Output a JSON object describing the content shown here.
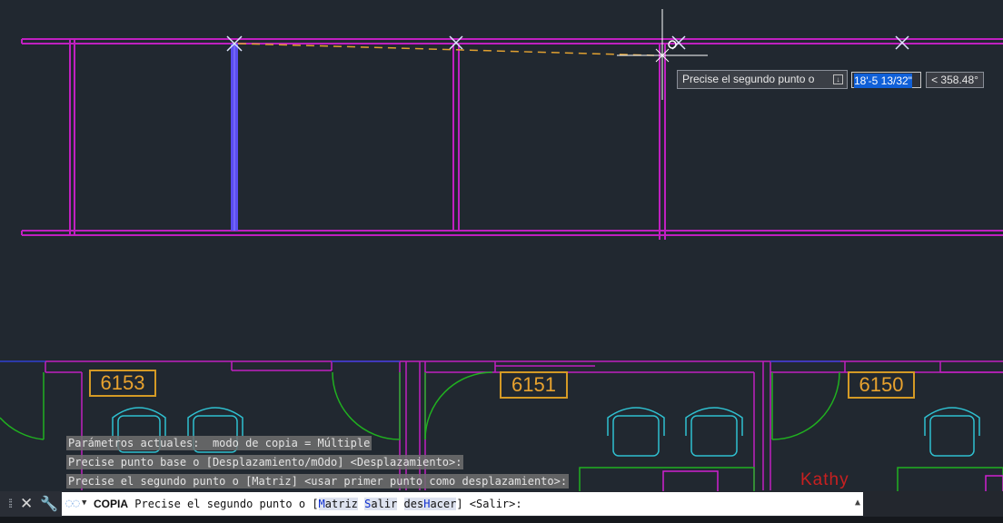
{
  "dynamic_input": {
    "prompt": "Precise el segundo punto o",
    "distance": "18'-5 13/32\"",
    "angle": "< 358.48°"
  },
  "rooms": [
    {
      "label": "6153"
    },
    {
      "label": "6151"
    },
    {
      "label": "6150"
    }
  ],
  "name_tag": "Kathy",
  "history": [
    "Parámetros actuales:  modo de copia = Múltiple",
    "Precise punto base o [Desplazamiento/mOdo] <Desplazamiento>:",
    "Precise el segundo punto o [Matriz] <usar primer punto como desplazamiento>:"
  ],
  "command_line": {
    "command": "COPIA",
    "prompt": "Precise el segundo punto o [",
    "options": [
      {
        "pre": "",
        "key": "M",
        "post": "atriz"
      },
      {
        "pre": "",
        "key": "S",
        "post": "alir"
      },
      {
        "pre": "des",
        "key": "H",
        "post": "acer"
      }
    ],
    "suffix": "] <Salir>:"
  },
  "colors": {
    "background": "#212830",
    "walls": "#c020c0",
    "selection": "#6a5cff",
    "rubber_band": "#e0a030",
    "room_tag": "#d49a25",
    "chair": "#2fc0d0",
    "door": "#20b020",
    "furniture": "#20c020"
  },
  "icons": [
    "grip-icon",
    "close-icon",
    "wrench-icon",
    "command-icon",
    "chevron-down-icon",
    "scroll-up-icon",
    "download-icon"
  ]
}
